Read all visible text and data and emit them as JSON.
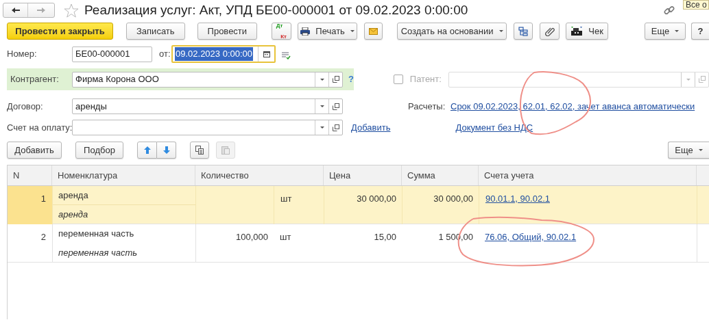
{
  "window": {
    "title": "Реализация услуг: Акт, УПД БЕ00-000001 от 09.02.2023 0:00:00",
    "tooltip": "Все о"
  },
  "toolbar": {
    "left": [
      {
        "kind": "primary",
        "label": "Провести и закрыть"
      },
      {
        "kind": "text",
        "label": "Записать"
      },
      {
        "kind": "text",
        "label": "Провести"
      },
      {
        "kind": "dtkt",
        "label": "Дт",
        "sublabel": "Кт"
      },
      {
        "kind": "print",
        "label": "Печать"
      },
      {
        "kind": "mail"
      },
      {
        "kind": "menu",
        "label": "Создать на основании"
      },
      {
        "kind": "structure"
      },
      {
        "kind": "clip"
      },
      {
        "kind": "receipt",
        "label": "Чек"
      }
    ],
    "right": [
      {
        "kind": "menu",
        "label": "Еще"
      },
      {
        "kind": "text",
        "label": "?"
      }
    ]
  },
  "number": {
    "label": "Номер:",
    "value": "БЕ00-000001"
  },
  "date": {
    "label": "от:",
    "value": "09.02.2023  0:00:00",
    "selected": true
  },
  "counterparty": {
    "label": "Контрагент:",
    "value": "Фирма Корона ООО",
    "help": "?"
  },
  "patent": {
    "label": "Патент:",
    "checked": false,
    "disabled": true
  },
  "contract": {
    "label": "Договор:",
    "value": "аренды"
  },
  "invoice": {
    "label": "Счет на оплату:",
    "add_link": "Добавить"
  },
  "settlements": {
    "label": "Расчеты:",
    "link": "Срок 09.02.2023, 62.01, 62.02, зачет аванса автоматически"
  },
  "vat_link": "Документ без НДС",
  "table_toolbar": {
    "add": "Добавить",
    "pick": "Подбор",
    "more": "Еще"
  },
  "table": {
    "columns": [
      "N",
      "Номенклатура",
      "Количество",
      "Цена",
      "Сумма",
      "Счета учета"
    ],
    "rows": [
      {
        "n": "1",
        "name": "аренда",
        "description": "аренда",
        "quantity": "",
        "unit": "шт",
        "price": "30 000,00",
        "sum": "30 000,00",
        "accounts": "90.01.1, 90.02.1",
        "selected": true
      },
      {
        "n": "2",
        "name": "переменная часть",
        "description": "переменная часть",
        "quantity": "100,000",
        "unit": "шт",
        "price": "15,00",
        "sum": "1 500,00",
        "accounts": "76.06, Общий, 90.02.1",
        "selected": false
      }
    ]
  }
}
